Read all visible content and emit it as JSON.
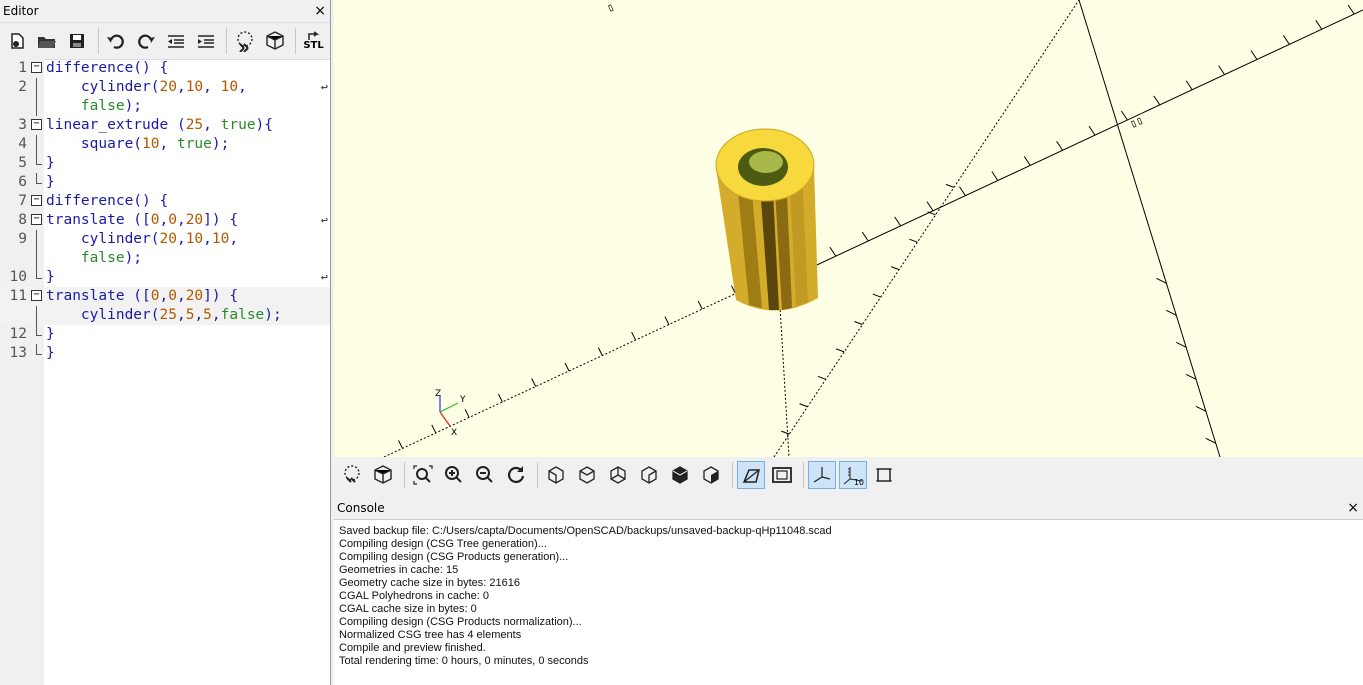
{
  "editor": {
    "title": "Editor",
    "close": "×",
    "lines": [
      {
        "num": "1",
        "parts": [
          {
            "t": "difference() {",
            "c": "k"
          }
        ]
      },
      {
        "num": "2",
        "parts": [
          {
            "t": "    cylinder(",
            "c": "k"
          },
          {
            "t": "20",
            "c": "n"
          },
          {
            "t": ",",
            "c": "k"
          },
          {
            "t": "10",
            "c": "n"
          },
          {
            "t": ", ",
            "c": "k"
          },
          {
            "t": "10",
            "c": "n"
          },
          {
            "t": ",",
            "c": "k"
          }
        ]
      },
      {
        "num": "",
        "parts": [
          {
            "t": "    ",
            "c": "k"
          },
          {
            "t": "false",
            "c": "b"
          },
          {
            "t": ");",
            "c": "k"
          }
        ]
      },
      {
        "num": "3",
        "parts": [
          {
            "t": "linear_extrude (",
            "c": "k"
          },
          {
            "t": "25",
            "c": "n"
          },
          {
            "t": ", ",
            "c": "k"
          },
          {
            "t": "true",
            "c": "b"
          },
          {
            "t": "){",
            "c": "k"
          }
        ]
      },
      {
        "num": "4",
        "parts": [
          {
            "t": "    square(",
            "c": "k"
          },
          {
            "t": "10",
            "c": "n"
          },
          {
            "t": ", ",
            "c": "k"
          },
          {
            "t": "true",
            "c": "b"
          },
          {
            "t": ");",
            "c": "k"
          }
        ]
      },
      {
        "num": "5",
        "parts": [
          {
            "t": "}",
            "c": "k"
          }
        ]
      },
      {
        "num": "6",
        "parts": [
          {
            "t": "}",
            "c": "k"
          }
        ]
      },
      {
        "num": "7",
        "parts": [
          {
            "t": "difference() {",
            "c": "k"
          }
        ]
      },
      {
        "num": "8",
        "parts": [
          {
            "t": "translate ([",
            "c": "k"
          },
          {
            "t": "0",
            "c": "n"
          },
          {
            "t": ",",
            "c": "k"
          },
          {
            "t": "0",
            "c": "n"
          },
          {
            "t": ",",
            "c": "k"
          },
          {
            "t": "20",
            "c": "n"
          },
          {
            "t": "]) {",
            "c": "k"
          }
        ]
      },
      {
        "num": "9",
        "parts": [
          {
            "t": "    cylinder(",
            "c": "k"
          },
          {
            "t": "20",
            "c": "n"
          },
          {
            "t": ",",
            "c": "k"
          },
          {
            "t": "10",
            "c": "n"
          },
          {
            "t": ",",
            "c": "k"
          },
          {
            "t": "10",
            "c": "n"
          },
          {
            "t": ",",
            "c": "k"
          }
        ]
      },
      {
        "num": "",
        "parts": [
          {
            "t": "    ",
            "c": "k"
          },
          {
            "t": "false",
            "c": "b"
          },
          {
            "t": ");",
            "c": "k"
          }
        ]
      },
      {
        "num": "10",
        "parts": [
          {
            "t": "}",
            "c": "k"
          }
        ]
      },
      {
        "num": "11",
        "parts": [
          {
            "t": "translate ([",
            "c": "k"
          },
          {
            "t": "0",
            "c": "n"
          },
          {
            "t": ",",
            "c": "k"
          },
          {
            "t": "0",
            "c": "n"
          },
          {
            "t": ",",
            "c": "k"
          },
          {
            "t": "20",
            "c": "n"
          },
          {
            "t": "]) {",
            "c": "k"
          }
        ]
      },
      {
        "num": "",
        "parts": [
          {
            "t": "    cylinder(",
            "c": "k"
          },
          {
            "t": "25",
            "c": "n"
          },
          {
            "t": ",",
            "c": "k"
          },
          {
            "t": "5",
            "c": "n"
          },
          {
            "t": ",",
            "c": "k"
          },
          {
            "t": "5",
            "c": "n"
          },
          {
            "t": ",",
            "c": "k"
          },
          {
            "t": "false",
            "c": "b"
          },
          {
            "t": ");",
            "c": "k"
          }
        ]
      },
      {
        "num": "12",
        "parts": [
          {
            "t": "}",
            "c": "k"
          }
        ]
      },
      {
        "num": "13",
        "parts": [
          {
            "t": "}",
            "c": "k"
          }
        ]
      }
    ],
    "toolbar": {
      "stl_label": "STL"
    }
  },
  "view": {
    "axis_label_x": "X",
    "axis_label_y": "Y",
    "axis_label_z": "Z",
    "scale_label": "10"
  },
  "console": {
    "title": "Console",
    "close": "×",
    "lines": [
      "Saved backup file: C:/Users/capta/Documents/OpenSCAD/backups/unsaved-backup-qHp11048.scad",
      "Compiling design (CSG Tree generation)...",
      "Compiling design (CSG Products generation)...",
      "Geometries in cache: 15",
      "Geometry cache size in bytes: 21616",
      "CGAL Polyhedrons in cache: 0",
      "CGAL cache size in bytes: 0",
      "Compiling design (CSG Products normalization)...",
      "Normalized CSG tree has 4 elements",
      "Compile and preview finished.",
      "Total rendering time: 0 hours, 0 minutes, 0 seconds"
    ]
  },
  "colors": {
    "viewport_bg": "#ffffe5",
    "model_top": "#f5d442",
    "model_side": "#d8b02a"
  }
}
